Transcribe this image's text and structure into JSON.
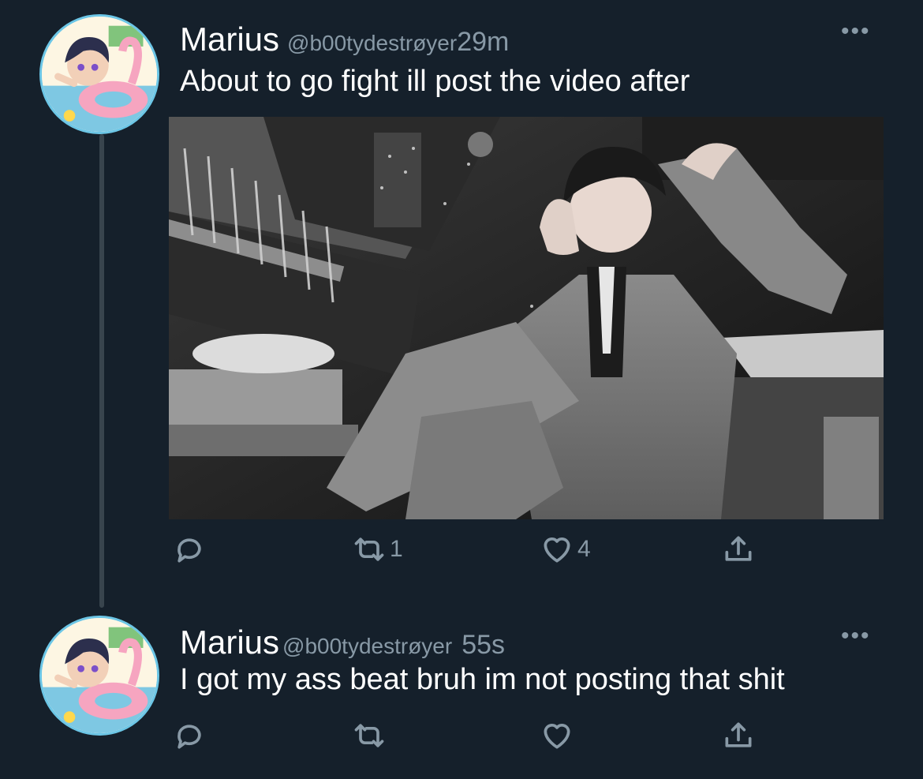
{
  "tweets": [
    {
      "name": "Marius",
      "handle": "@b00tydestrøyer",
      "time": "29m",
      "text": "About to go fight ill post the video after",
      "actions": {
        "replies": "",
        "retweets": "1",
        "likes": "4"
      }
    },
    {
      "name": "Marius",
      "handle": "@b00tydestrøyer",
      "time": "55s",
      "text": "I got my ass beat bruh im not posting that shit",
      "actions": {
        "replies": "",
        "retweets": "",
        "likes": ""
      }
    }
  ],
  "icons": {
    "reply": "reply-icon",
    "retweet": "retweet-icon",
    "like": "heart-icon",
    "share": "share-icon",
    "more": "more-icon"
  },
  "colors": {
    "background": "#15202b",
    "secondary_text": "#8899a6",
    "thread_line": "#38444d",
    "avatar_ring": "#6cc6e6"
  }
}
